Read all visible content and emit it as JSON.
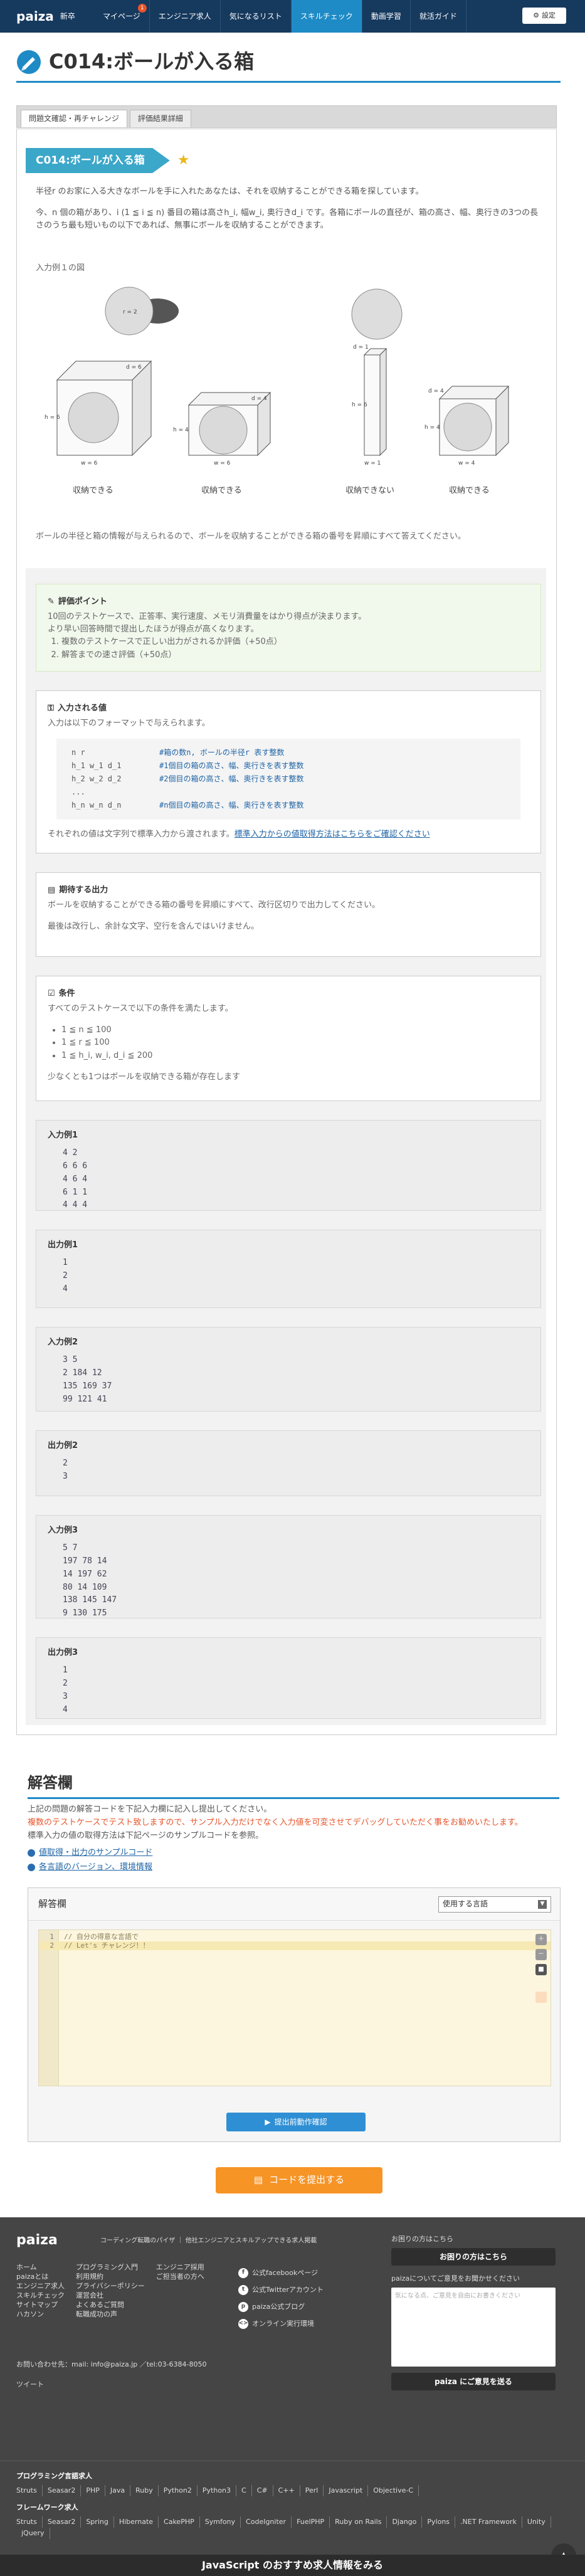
{
  "header": {
    "logo": "paiza",
    "logo_sub": "新卒",
    "nav": [
      {
        "label": "マイページ",
        "badge": "1"
      },
      {
        "label": "エンジニア求人"
      },
      {
        "label": "気になるリスト"
      },
      {
        "label": "スキルチェック",
        "active": true
      },
      {
        "label": "動画学習"
      },
      {
        "label": "就活ガイド"
      }
    ],
    "user_label": "設定"
  },
  "page_title": "C014:ボールが入る箱",
  "tabs": [
    "問題文確認・再チャレンジ",
    "評価結果詳細"
  ],
  "problem": {
    "tag": "C014:ボールが入る箱",
    "star": "★",
    "intro1": "半径r のお家に入る大きなボールを手に入れたあなたは、それを収納することができる箱を探しています。",
    "intro2": "今、n 個の箱があり、i (1 ≦ i ≦ n) 番目の箱は高さh_i, 幅w_i, 奥行きd_i です。各箱にボールの直径が、箱の高さ、幅、奥行きの3つの長さのうち最も短いもの以下であれば、無事にボールを収納することができます。",
    "figure_caption": "入力例１の図",
    "figure_labels": [
      "収納できる",
      "収納できる",
      "収納できない",
      "収納できる"
    ],
    "summary": "ボールの半径と箱の情報が与えられるので、ボールを収納することができる箱の番号を昇順にすべて答えてください。"
  },
  "eval": {
    "title": "評価ポイント",
    "desc1": "10回のテストケースで、正答率、実行速度、メモリ消費量をはかり得点が決まります。",
    "desc2": "より早い回答時間で提出したほうが得点が高くなります。",
    "points": [
      "複数のテストケースで正しい出力がされるか評価（+50点）",
      "解答までの速さ評価（+50点）"
    ]
  },
  "input_spec": {
    "title": "入力される値",
    "desc": "入力は以下のフォーマットで与えられます。",
    "rows": [
      {
        "var": "n r",
        "note": "#箱の数n, ボールの半径r 表す整数"
      },
      {
        "var": "h_1 w_1 d_1",
        "note": "#1個目の箱の高さ、幅、奥行きを表す整数"
      },
      {
        "var": "h_2 w_2 d_2",
        "note": "#2個目の箱の高さ、幅、奥行きを表す整数"
      },
      {
        "var": "...",
        "note": ""
      },
      {
        "var": "h_n w_n d_n",
        "note": "#n個目の箱の高さ、幅、奥行きを表す整数"
      }
    ],
    "footer": "それぞれの値は文字列で標準入力から渡されます。",
    "footer_link": "標準入力からの値取得方法はこちらをご確認ください"
  },
  "output_spec": {
    "title": "期待する出力",
    "desc1": "ボールを収納することができる箱の番号を昇順にすべて、改行区切りで出力してください。",
    "desc2": "最後は改行し、余計な文字、空行を含んではいけません。"
  },
  "conditions": {
    "title": "条件",
    "desc": "すべてのテストケースで以下の条件を満たします。",
    "items": [
      "1 ≦ n ≦ 100",
      "1 ≦ r ≦ 100",
      "1 ≦ h_i, w_i, d_i ≦ 200"
    ],
    "footer": "少なくとも1つはボールを収納できる箱が存在します"
  },
  "examples": [
    {
      "title": "入力例1",
      "text": "4 2\n6 6 6\n4 6 4\n6 1 1\n4 4 4"
    },
    {
      "title": "出力例1",
      "text": "1\n2\n4"
    },
    {
      "title": "入力例2",
      "text": "3 5\n2 184 12\n135 169 37\n99 121 41"
    },
    {
      "title": "出力例2",
      "text": "2\n3"
    },
    {
      "title": "入力例3",
      "text": "5 7\n197 78 14\n14 197 62\n80 14 109\n138 145 147\n9 130 175"
    },
    {
      "title": "出力例3",
      "text": "1\n2\n3\n4"
    }
  ],
  "answer": {
    "title": "解答欄",
    "note1": "上記の問題の解答コードを下記入力欄に記入し提出してください。",
    "note2": "複数のテストケースでテスト致しますので、サンプル入力だけでなく入力値を可変させてデバッグしていただく事をお勧めいたします。",
    "note3": "標準入力の値の取得方法は下記ページのサンプルコードを参照。",
    "link1": "値取得・出力のサンプルコード",
    "link2": "各言語のバージョン、環境情報",
    "editor_title": "解答欄",
    "lang_placeholder": "使用する言語",
    "code_lines": [
      "// 自分の得意な言語で",
      "// Let's チャレンジ！！"
    ],
    "check_btn": "提出前動作確認",
    "submit_btn": "コードを提出する"
  },
  "footer": {
    "logo": "paiza",
    "tagline": "コーディング転職のパイザ ｜ 他社エンジニアとスキルアップできる求人掲載",
    "col1": [
      "ホーム",
      "paizaとは",
      "エンジニア求人",
      "スキルチェック",
      "サイトマップ",
      "ハカソン"
    ],
    "col2": [
      "プログラミング入門",
      "利用規約",
      "プライバシーポリシー",
      "運営会社",
      "よくあるご質問",
      "転職成功の声"
    ],
    "col3": [
      "エンジニア採用",
      "ご担当者の方へ"
    ],
    "social": [
      "公式facebookページ",
      "公式Twitterアカウント",
      "paiza公式ブログ",
      "オンライン実行環境"
    ],
    "contact": "お問い合わせ先：mail: info@paiza.jp ／tel:03-6384-8050",
    "tweet": "ツイート",
    "help_label": "お困りの方はこちら",
    "help_btn": "お困りの方はこちら",
    "opinion_label": "paizaについてご意見をお聞かせください",
    "opinion_placeholder": "気になる点、ご意見を自由にお書きください",
    "opinion_btn": "paiza にご意見を送る",
    "prog_title": "プログラミング言語求人",
    "prog_langs": [
      "Struts",
      "Seasar2",
      "PHP",
      "Java",
      "Ruby",
      "Python2",
      "Python3",
      "C",
      "C#",
      "C++",
      "Perl",
      "Javascript",
      "Objective-C"
    ],
    "fw_title": "フレームワーク求人",
    "fw_list": [
      "Struts",
      "Seasar2",
      "Spring",
      "Hibernate",
      "CakePHP",
      "Symfony",
      "CodeIgniter",
      "FuelPHP",
      "Ruby on Rails",
      "Django",
      "Pylons",
      ".NET Framework",
      "Unity",
      "jQuery"
    ],
    "banner": "JavaScript のおすすめ求人情報をみる",
    "to_top": "▲"
  }
}
